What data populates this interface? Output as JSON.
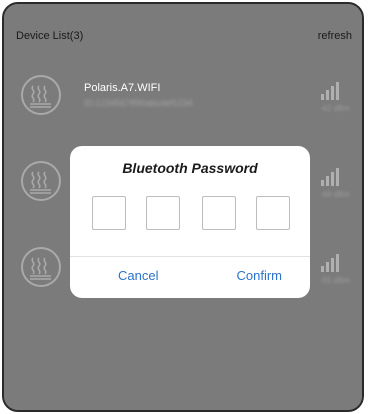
{
  "header": {
    "title": "Device List(3)",
    "refresh_label": "refresh"
  },
  "devices": [
    {
      "name": "Polaris.A7.WIFI",
      "id": "ID:1234567890abcdef1234",
      "rssi": "-42 dBm"
    },
    {
      "name": "",
      "id": "",
      "rssi": "-48 dBm"
    },
    {
      "name": "",
      "id": "",
      "rssi": "-55 dBm"
    }
  ],
  "dialog": {
    "title": "Bluetooth Password",
    "cancel_label": "Cancel",
    "confirm_label": "Confirm"
  },
  "colors": {
    "overlay_bg": "#7b7b7b",
    "modal_bg": "#ffffff",
    "accent": "#2d73c8"
  },
  "icons": {
    "device_icon": "heater-waves-icon",
    "signal_icon": "signal-bars-icon"
  }
}
